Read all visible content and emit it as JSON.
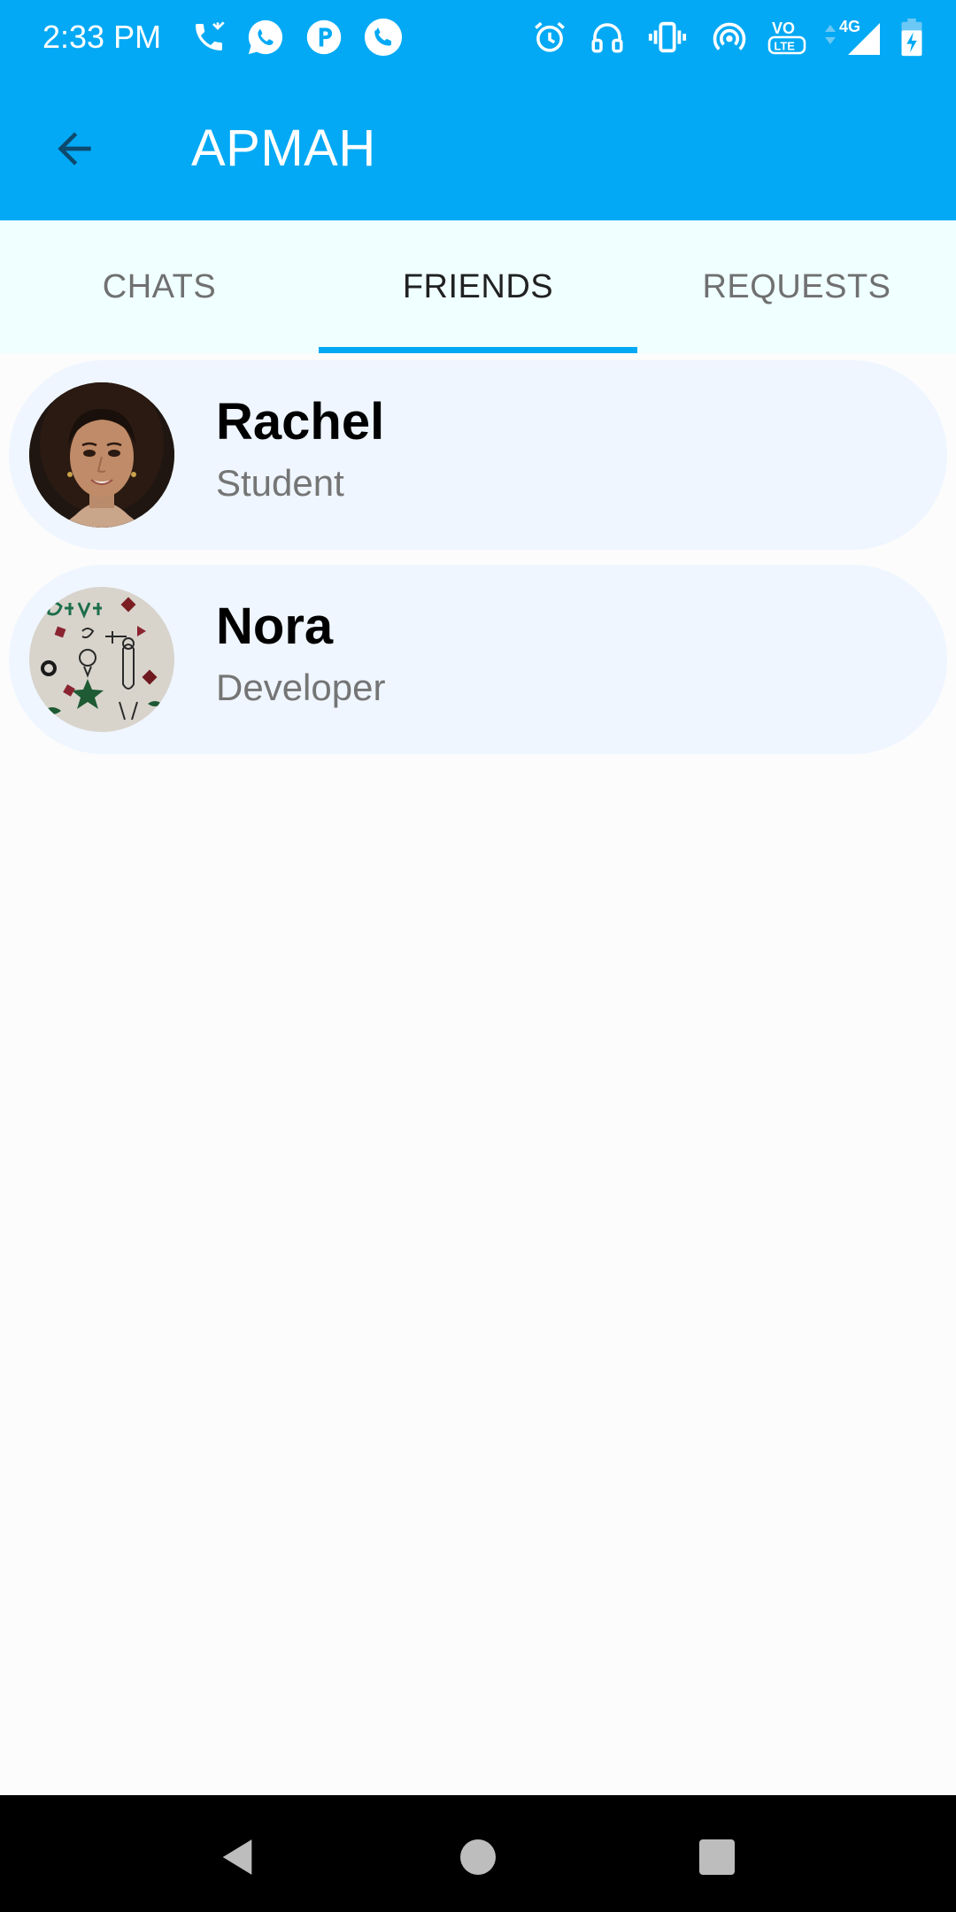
{
  "status_bar": {
    "time": "2:33 PM",
    "icons": [
      "missed-call-icon",
      "whatsapp-icon",
      "p-app-icon",
      "phone-call-icon",
      "alarm-icon",
      "headset-icon",
      "vibrate-icon",
      "hotspot-icon",
      "volte-icon",
      "signal-4g-icon",
      "battery-charging-icon"
    ],
    "volte_label": "VO LTE",
    "network_label": "4G"
  },
  "app_bar": {
    "title": "APMAH",
    "back_icon": "arrow-back-icon"
  },
  "tabs": [
    {
      "label": "CHATS",
      "active": false
    },
    {
      "label": "FRIENDS",
      "active": true
    },
    {
      "label": "REQUESTS",
      "active": false
    }
  ],
  "friends": [
    {
      "name": "Rachel",
      "role": "Student",
      "avatar": "woman-portrait"
    },
    {
      "name": "Nora",
      "role": "Developer",
      "avatar": "dream-tracker-drawing"
    }
  ],
  "nav_bar": {
    "back": "nav-back-icon",
    "home": "nav-home-icon",
    "recents": "nav-recents-icon"
  },
  "colors": {
    "primary": "#03A9F4",
    "tab_bg": "#F0FFFF",
    "card_bg": "#EFF6FF",
    "background": "#FCFCFC",
    "active_tab_text": "#212121",
    "inactive_tab_text": "#707070",
    "secondary_text": "#757575"
  }
}
